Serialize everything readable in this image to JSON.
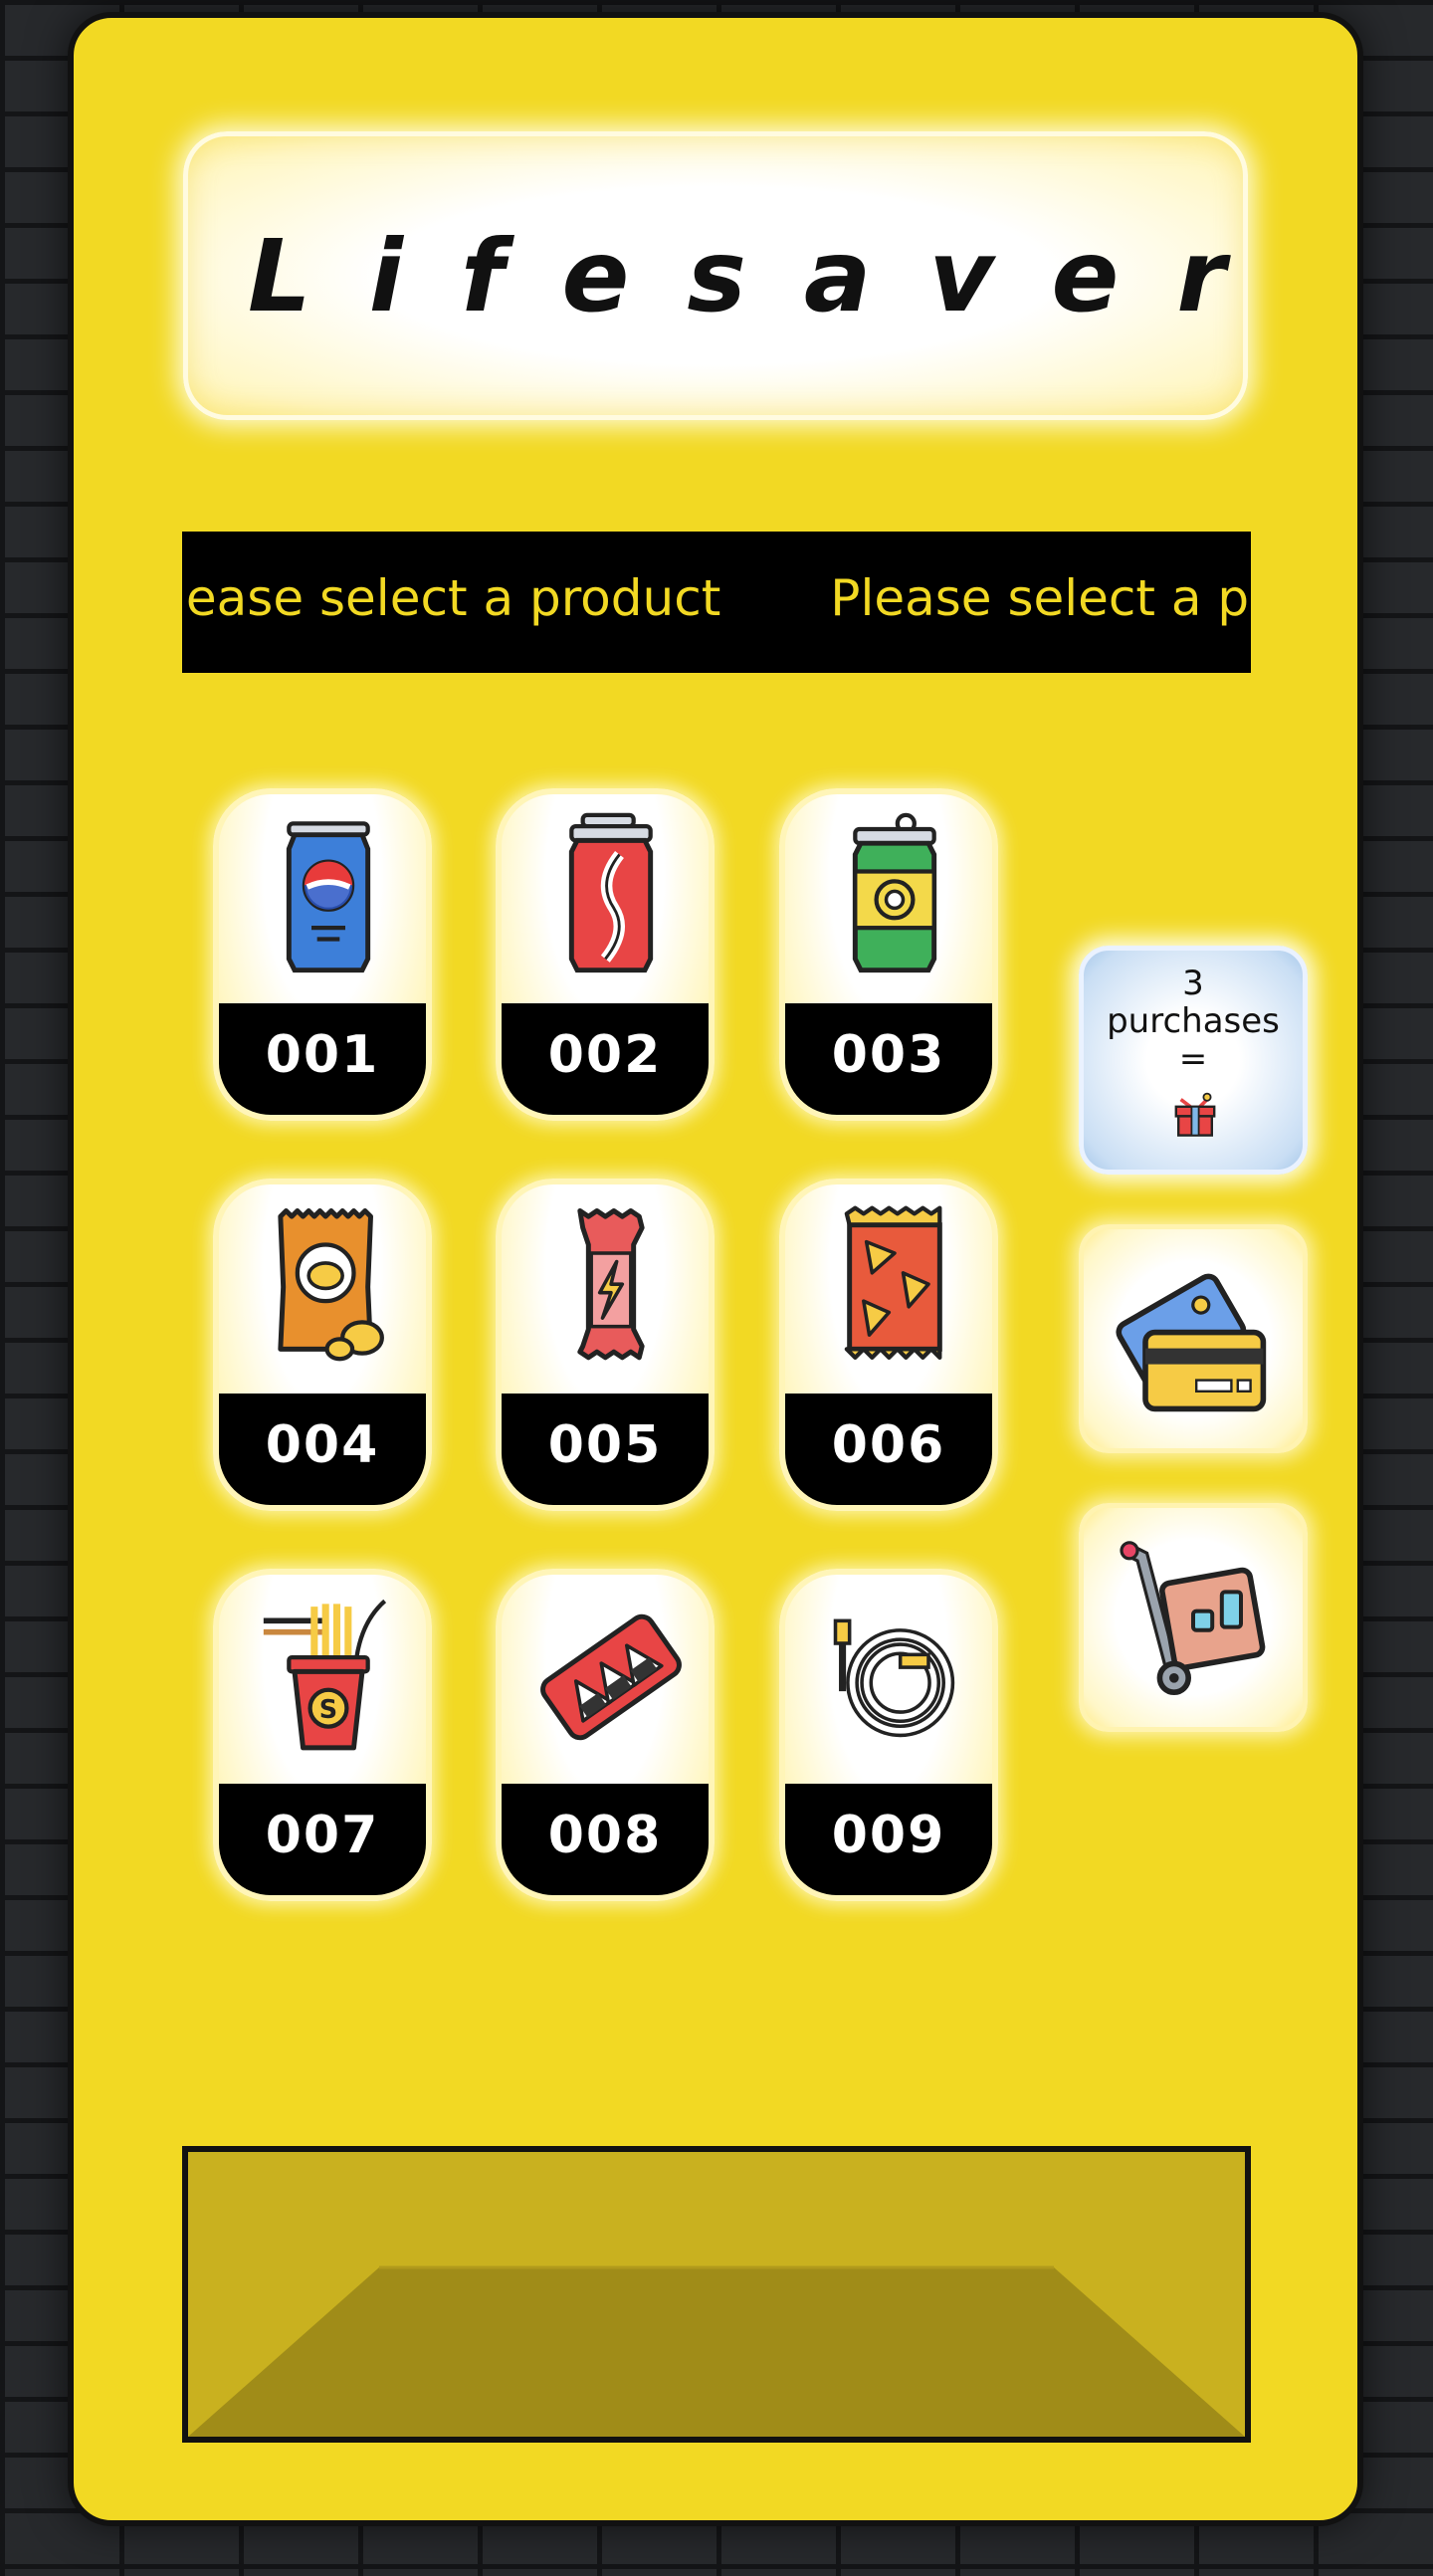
{
  "brand": {
    "name": "Lifesaver"
  },
  "marquee": {
    "text_a": "lease select a product",
    "text_b": "Please select a p"
  },
  "products": [
    {
      "code": "001",
      "icon": "soda-can-blue-icon"
    },
    {
      "code": "002",
      "icon": "soda-can-red-icon"
    },
    {
      "code": "003",
      "icon": "soda-can-green-icon"
    },
    {
      "code": "004",
      "icon": "potato-chips-bag-icon"
    },
    {
      "code": "005",
      "icon": "energy-bar-icon"
    },
    {
      "code": "006",
      "icon": "nacho-chips-bag-icon"
    },
    {
      "code": "007",
      "icon": "noodle-cup-icon"
    },
    {
      "code": "008",
      "icon": "onigiri-tray-icon"
    },
    {
      "code": "009",
      "icon": "charging-cable-icon"
    }
  ],
  "sidebar": {
    "promo": {
      "line1": "3",
      "line2": "purchases",
      "line3": "=",
      "icon": "gift-box-icon"
    },
    "payment": {
      "icon": "credit-card-icon"
    },
    "delivery": {
      "icon": "hand-truck-icon"
    }
  },
  "colors": {
    "machine": "#f2d923",
    "marquee_text": "#f2d923",
    "code_bg": "#000000"
  }
}
